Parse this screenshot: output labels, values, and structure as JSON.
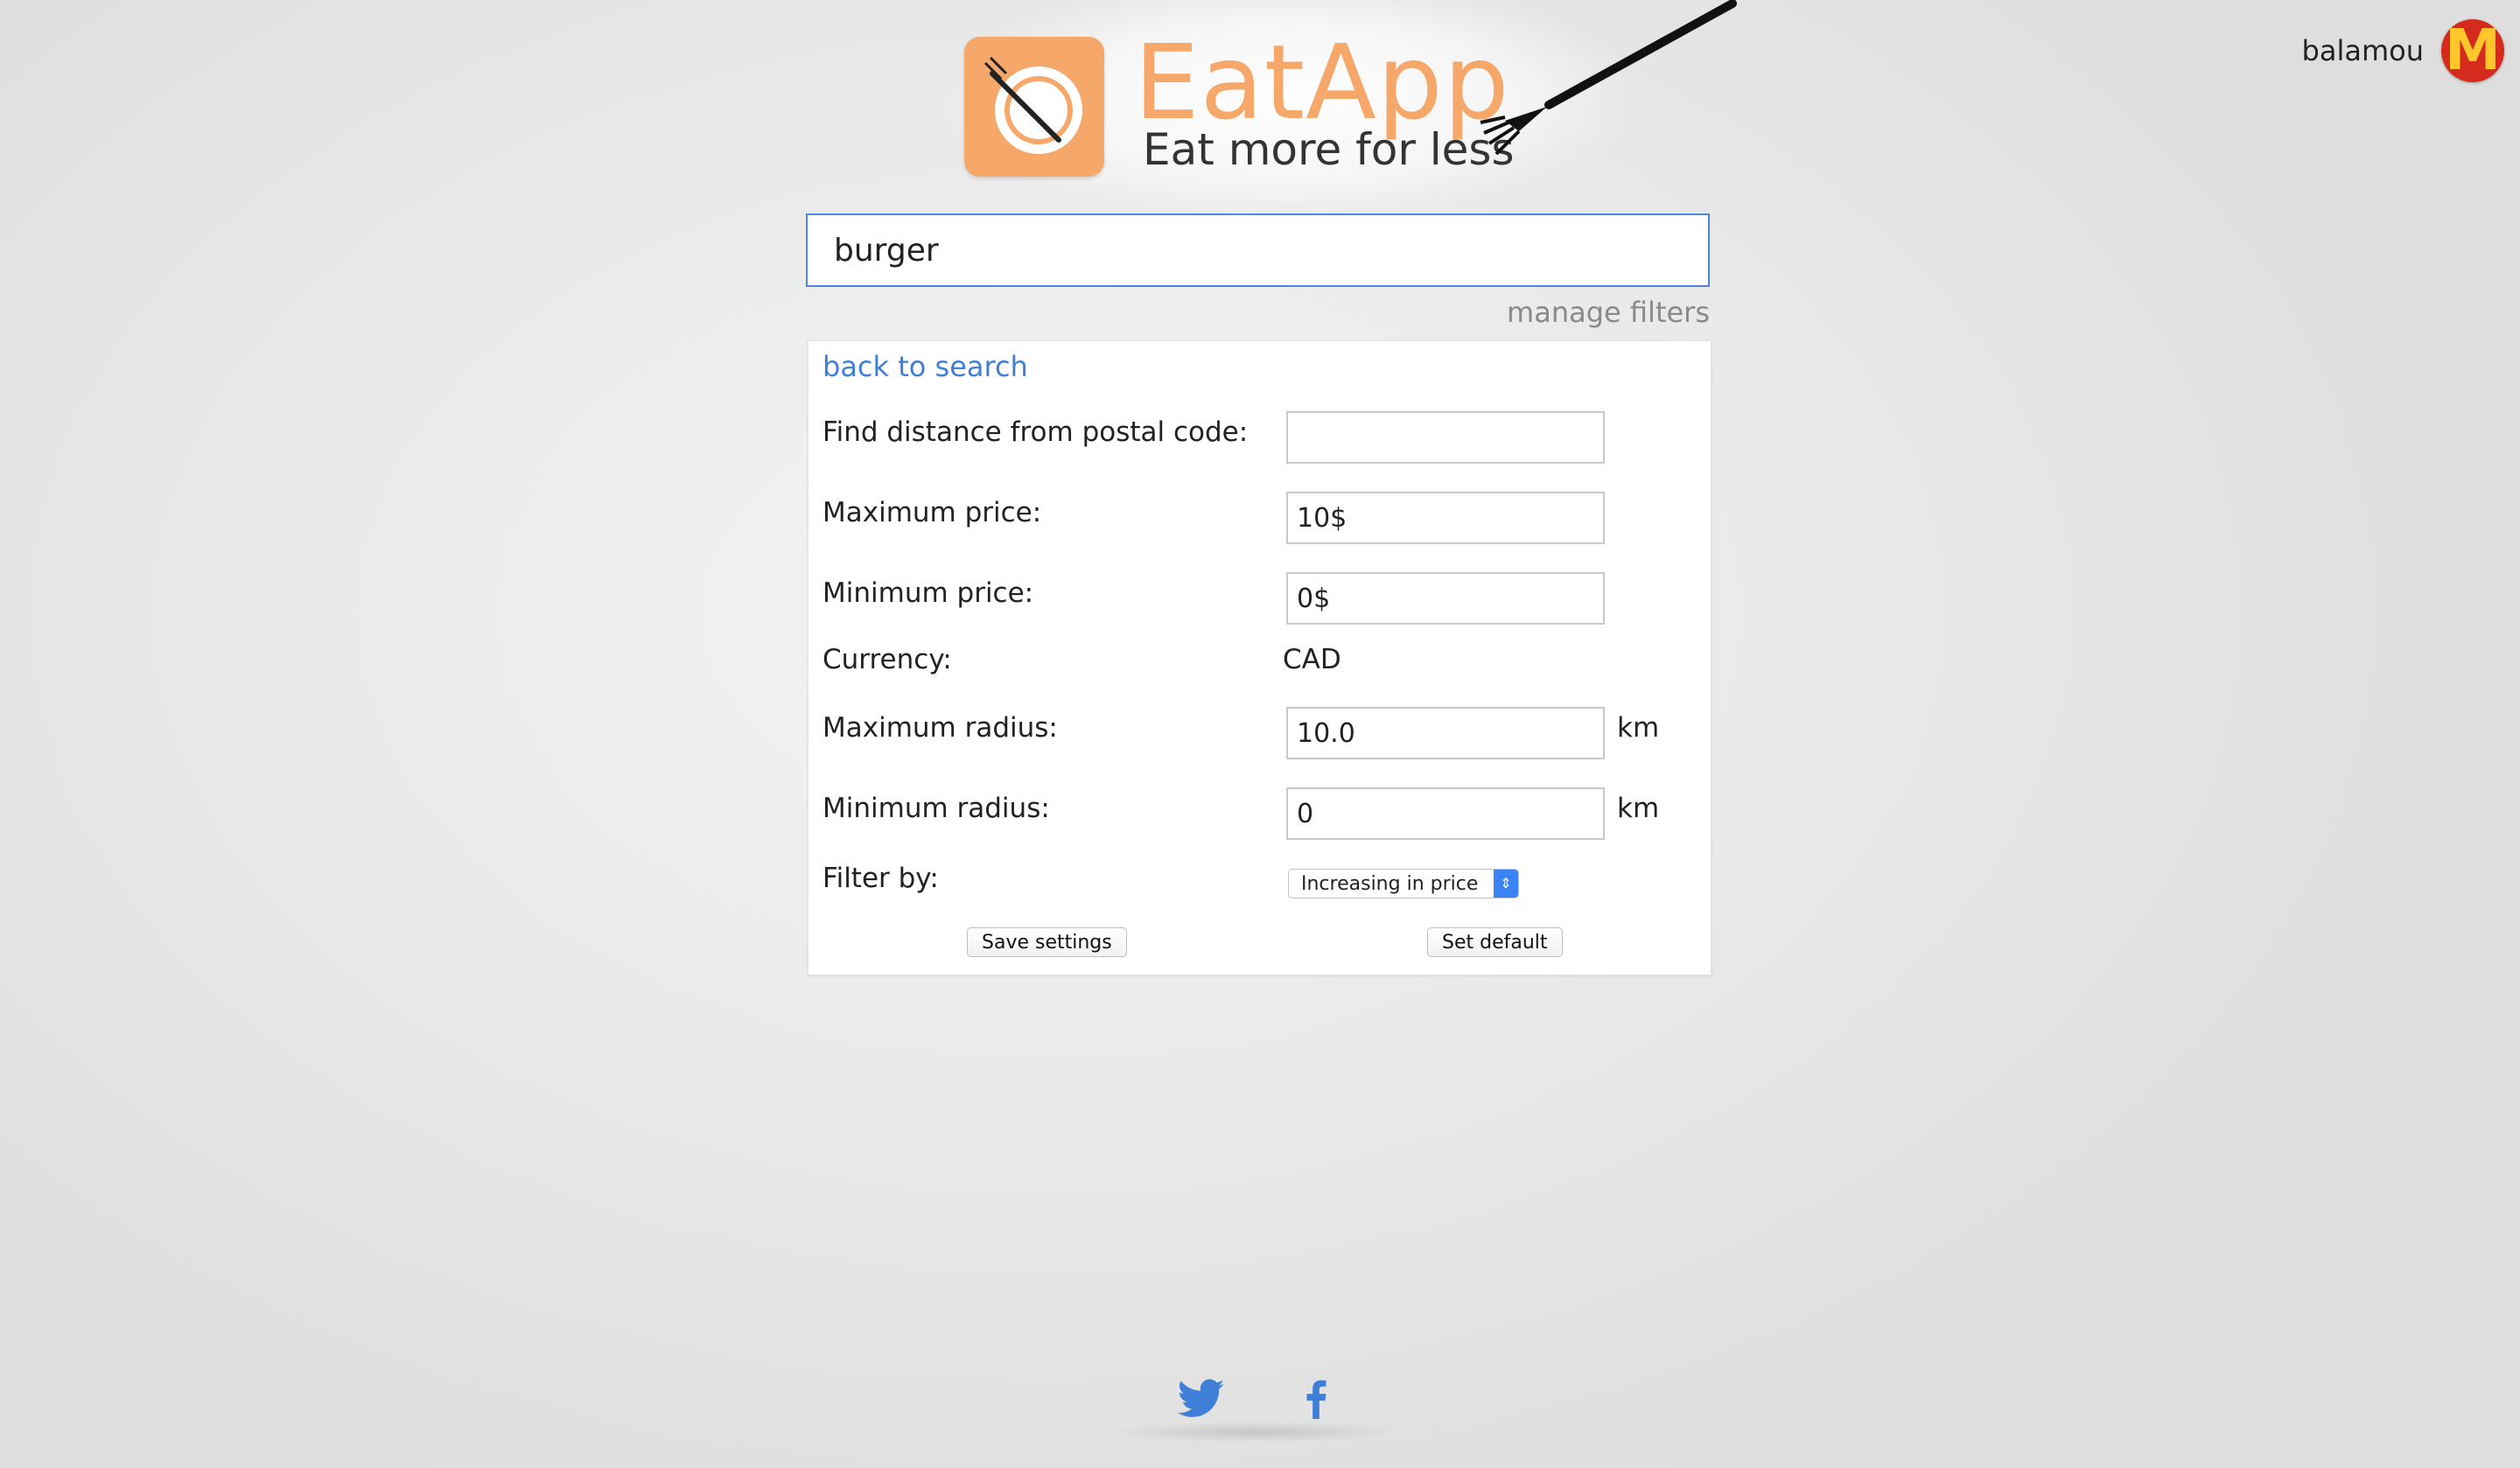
{
  "user": {
    "name": "balamou",
    "avatar_letter": "M",
    "avatar_color": "#d52b1e",
    "avatar_letter_color": "#ffc72c"
  },
  "brand": {
    "name": "EatApp",
    "tagline": "Eat more for less",
    "color": "#f5a86a"
  },
  "search": {
    "value": "burger"
  },
  "manage_filters_label": "manage filters",
  "settings": {
    "back_label": "back to search",
    "postal_code": {
      "label": "Find distance from postal code:",
      "value": ""
    },
    "max_price": {
      "label": "Maximum price:",
      "value": "10$"
    },
    "min_price": {
      "label": "Minimum price:",
      "value": "0$"
    },
    "currency": {
      "label": "Currency:",
      "value": "CAD"
    },
    "max_radius": {
      "label": "Maximum radius:",
      "value": "10.0",
      "unit": "km"
    },
    "min_radius": {
      "label": "Minimum radius:",
      "value": "0",
      "unit": "km"
    },
    "filter_by": {
      "label": "Filter by:",
      "value": "Increasing in price"
    },
    "save_label": "Save settings",
    "default_label": "Set default"
  },
  "footer": {
    "icons": [
      "twitter-icon",
      "facebook-icon"
    ],
    "icon_color": "#3f7fd8"
  }
}
